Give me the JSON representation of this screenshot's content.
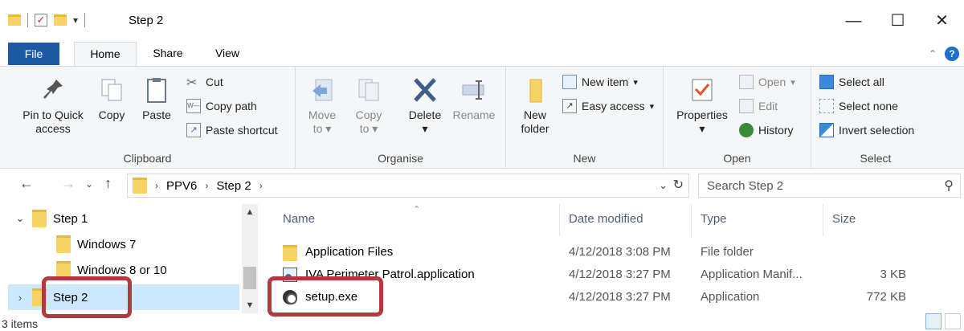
{
  "window": {
    "title": "Step 2",
    "minimize": "—",
    "maximize": "☐",
    "close": "✕"
  },
  "ribbon_tabs": [
    "File",
    "Home",
    "Share",
    "View"
  ],
  "ribbon": {
    "clipboard": {
      "label": "Clipboard",
      "pin_line1": "Pin to Quick",
      "pin_line2": "access",
      "copy": "Copy",
      "paste": "Paste",
      "cut": "Cut",
      "copy_path": "Copy path",
      "paste_shortcut": "Paste shortcut"
    },
    "organise": {
      "label": "Organise",
      "move_to_1": "Move",
      "move_to_2": "to",
      "copy_to_1": "Copy",
      "copy_to_2": "to",
      "delete": "Delete",
      "rename": "Rename"
    },
    "new": {
      "label": "New",
      "new_folder_1": "New",
      "new_folder_2": "folder",
      "new_item": "New item",
      "easy_access": "Easy access"
    },
    "open": {
      "label": "Open",
      "properties": "Properties",
      "open": "Open",
      "edit": "Edit",
      "history": "History"
    },
    "select": {
      "label": "Select",
      "select_all": "Select all",
      "select_none": "Select none",
      "invert_selection": "Invert selection"
    }
  },
  "address": {
    "crumbs": [
      "PPV6",
      "Step 2"
    ],
    "search_placeholder": "Search Step 2"
  },
  "nav_pane": {
    "items": [
      {
        "label": "Step 1",
        "chevron": "⌄"
      },
      {
        "label": "Windows 7",
        "chevron": ""
      },
      {
        "label": "Windows 8 or 10",
        "chevron": ""
      },
      {
        "label": "Step 2",
        "chevron": "›"
      }
    ]
  },
  "file_list": {
    "columns": {
      "name": "Name",
      "date": "Date modified",
      "type": "Type",
      "size": "Size"
    },
    "rows": [
      {
        "name": "Application Files",
        "date": "4/12/2018 3:08 PM",
        "type": "File folder",
        "size": "",
        "icon": "folder-icon"
      },
      {
        "name": "IVA Perimeter Patrol.application",
        "date": "4/12/2018 3:27 PM",
        "type": "Application Manif...",
        "size": "3 KB",
        "icon": "application-manifest-icon"
      },
      {
        "name": "setup.exe",
        "date": "4/12/2018 3:27 PM",
        "type": "Application",
        "size": "772 KB",
        "icon": "setup-exe-icon"
      }
    ]
  },
  "status": {
    "item_count": "3 items"
  },
  "colors": {
    "file_tab": "#1c5aa6",
    "selection": "#cce8ff",
    "highlight": "#b23a3f"
  }
}
